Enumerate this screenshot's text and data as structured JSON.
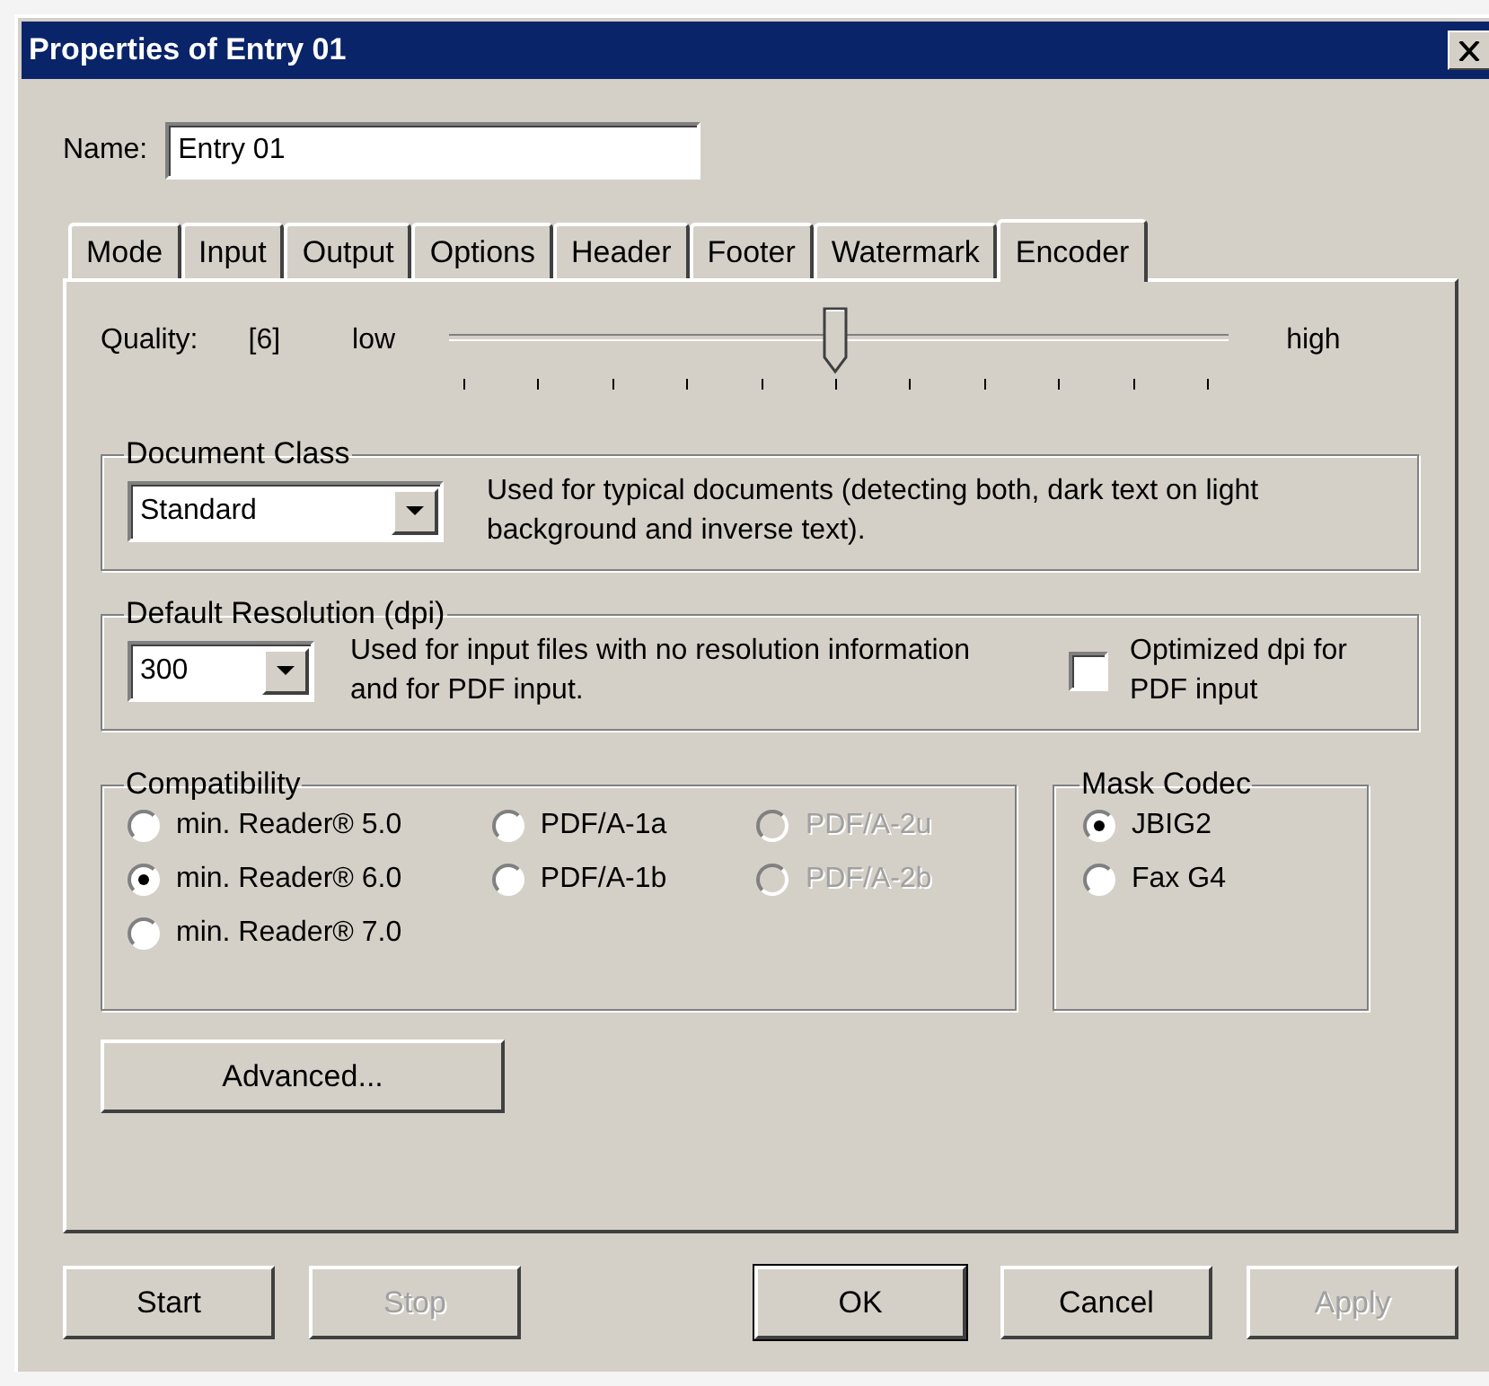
{
  "window": {
    "title": "Properties of Entry 01"
  },
  "name": {
    "label": "Name:",
    "value": "Entry 01"
  },
  "tabs": [
    {
      "label": "Mode",
      "selected": false
    },
    {
      "label": "Input",
      "selected": false
    },
    {
      "label": "Output",
      "selected": false
    },
    {
      "label": "Options",
      "selected": false
    },
    {
      "label": "Header",
      "selected": false
    },
    {
      "label": "Footer",
      "selected": false
    },
    {
      "label": "Watermark",
      "selected": false
    },
    {
      "label": "Encoder",
      "selected": true
    }
  ],
  "quality": {
    "label": "Quality:",
    "reading": "[6]",
    "min_label": "low",
    "max_label": "high",
    "level": 0.5
  },
  "document_class": {
    "title": "Document Class",
    "value": "Standard",
    "description": "Used for typical documents (detecting both, dark text on light background and inverse text)."
  },
  "resolution": {
    "title": "Default Resolution (dpi)",
    "value": "300",
    "description": "Used for input files with no resolution information and for PDF input.",
    "option": {
      "label": "Optimized dpi for PDF input",
      "checked": false
    }
  },
  "compatibility": {
    "title": "Compatibility",
    "options": [
      {
        "label": "min. Reader® 5.0",
        "selected": false,
        "disabled": false
      },
      {
        "label": "PDF/A-1a",
        "selected": false,
        "disabled": false
      },
      {
        "label": "PDF/A-2u",
        "selected": false,
        "disabled": true
      },
      {
        "label": "min. Reader® 6.0",
        "selected": true,
        "disabled": false
      },
      {
        "label": "PDF/A-1b",
        "selected": false,
        "disabled": false
      },
      {
        "label": "PDF/A-2b",
        "selected": false,
        "disabled": true
      },
      {
        "label": "min. Reader® 7.0",
        "selected": false,
        "disabled": false
      }
    ]
  },
  "mask_codec": {
    "title": "Mask Codec",
    "options": [
      {
        "label": "JBIG2",
        "selected": true,
        "disabled": false
      },
      {
        "label": "Fax G4",
        "selected": false,
        "disabled": false
      }
    ]
  },
  "advanced_button": "Advanced...",
  "left_buttons": [
    {
      "label": "Start",
      "disabled": false,
      "default": false
    },
    {
      "label": "Stop",
      "disabled": true,
      "default": false
    }
  ],
  "right_buttons": [
    {
      "label": "OK",
      "disabled": false,
      "default": true
    },
    {
      "label": "Cancel",
      "disabled": false,
      "default": false
    },
    {
      "label": "Apply",
      "disabled": true,
      "default": false
    }
  ]
}
